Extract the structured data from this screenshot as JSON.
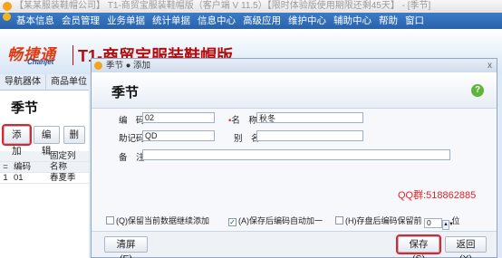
{
  "titlebar": {
    "text": "【某某服装鞋帽公司】 T1-商贸宝服装鞋帽版（客户端 V 11.5）【限时体验版使用期限还剩45天】 - [季节]"
  },
  "menubar": {
    "items": [
      "基本信息",
      "会员管理",
      "业务单据",
      "统计单据",
      "信息中心",
      "高级应用",
      "维护中心",
      "辅助中心",
      "帮助",
      "窗口"
    ]
  },
  "banner": {
    "brand": "畅捷通",
    "brand_sub": "Chanjet",
    "product": "T1-商贸宝服装鞋帽版"
  },
  "left": {
    "tabs": [
      "导航器体",
      "商品单位"
    ],
    "title": "季节",
    "buttons": {
      "add": "添加",
      "edit": "编辑",
      "more": "删"
    },
    "table": {
      "group_header": "固定列",
      "header": [
        "=",
        "编码",
        "名称"
      ],
      "rows": [
        {
          "idx": "1",
          "code": "01",
          "name": "春夏季"
        }
      ]
    }
  },
  "dialog": {
    "window_title": "季节 ● 添加",
    "close": "x",
    "header_title": "季节",
    "help": "?",
    "fields": {
      "code_label": "编　码",
      "code_value": "02",
      "name_label": "名　称",
      "name_value": "秋冬",
      "mnemonic_label": "助记码",
      "mnemonic_value": "QD",
      "alias_label": "别　名",
      "alias_value": "",
      "note_label": "备　注",
      "note_value": ""
    },
    "qq": "QQ群:518862885",
    "options": {
      "keep_data": "(Q)保留当前数据继续添加",
      "auto_inc": "(A)保存后编码自动加一",
      "reserve": "(H)存盘后编码保留前",
      "reserve_value": "0",
      "reserve_unit": "位"
    },
    "buttons": {
      "clear": "清屏(E)",
      "save": "保存(S)",
      "back": "返回(X)"
    }
  }
}
